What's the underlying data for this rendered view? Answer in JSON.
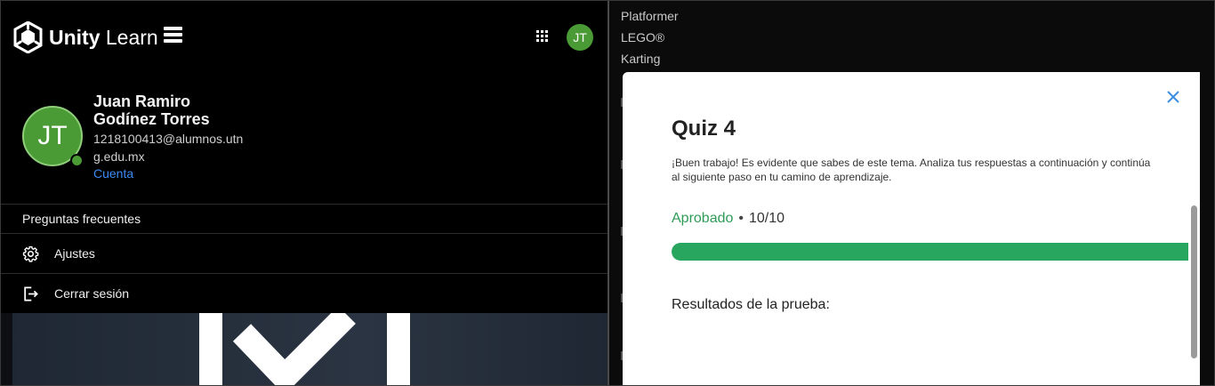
{
  "header": {
    "brand_bold": "Unity",
    "brand_light": " Learn",
    "avatar_initials": "JT"
  },
  "profile": {
    "initials": "JT",
    "name": "Juan Ramiro Godínez Torres",
    "email": "1218100413@alumnos.utng.edu.mx",
    "account_link": "Cuenta"
  },
  "menu": {
    "faq": "Preguntas frecuentes",
    "settings": "Ajustes",
    "logout": "Cerrar sesión"
  },
  "background_nav": [
    "Platformer",
    "LEGO®",
    "Karting"
  ],
  "quiz": {
    "title": "Quiz 4",
    "message": "¡Buen trabajo! Es evidente que sabes de este tema. Analiza tus respuestas a continuación y continúa al siguiente paso en tu camino de aprendizaje.",
    "status": "Aprobado",
    "score": "10/10",
    "progress_fraction": 1.0,
    "results_heading": "Resultados de la prueba:"
  },
  "colors": {
    "accent_green": "#28a55f",
    "link_blue": "#3c8bf5",
    "avatar_green": "#4a9a35"
  },
  "icons": {
    "logo": "unity-cube-logo",
    "menu": "hamburger-icon",
    "apps": "grid-apps-icon",
    "settings": "gear-icon",
    "logout": "logout-icon",
    "close": "close-icon"
  }
}
